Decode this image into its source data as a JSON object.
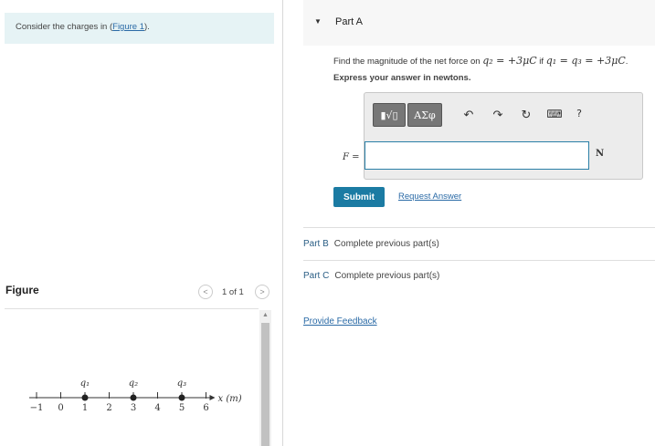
{
  "problem": {
    "prompt_before": "Consider the charges in (",
    "prompt_link": "Figure 1",
    "prompt_after": ")."
  },
  "figure_panel": {
    "title": "Figure",
    "page": "1 of 1",
    "axis": {
      "tick_labels": [
        "−1",
        "0",
        "1",
        "2",
        "3",
        "4",
        "5",
        "6"
      ],
      "axis_label": "x (m)",
      "charges": [
        {
          "name": "q1",
          "position": 1
        },
        {
          "name": "q2",
          "position": 3
        },
        {
          "name": "q3",
          "position": 5
        }
      ]
    }
  },
  "part_a": {
    "label": "Part A",
    "question_prefix": "Find the magnitude of the net force on ",
    "question_eq1": "q₂ = +3μC",
    "question_if": " if ",
    "question_eq2": "q₁ = q₃ = +3μC",
    "question_suffix": ".",
    "instruction": "Express your answer in newtons.",
    "toolbar": {
      "templates_label": "▮√▯",
      "symbols_label": "ΑΣφ",
      "undo_glyph": "↶",
      "redo_glyph": "↷",
      "reset_glyph": "↻",
      "keyboard_glyph": "⌨",
      "help_glyph": "?"
    },
    "variable_label": "F =",
    "answer_value": "",
    "unit": "N",
    "submit_label": "Submit",
    "request_answer_label": "Request Answer"
  },
  "part_b": {
    "name": "Part B",
    "status": "Complete previous part(s)"
  },
  "part_c": {
    "name": "Part C",
    "status": "Complete previous part(s)"
  },
  "feedback_label": "Provide Feedback",
  "icons": {
    "caret": "caret-down-icon",
    "prev": "chevron-left-icon",
    "next": "chevron-right-icon"
  }
}
